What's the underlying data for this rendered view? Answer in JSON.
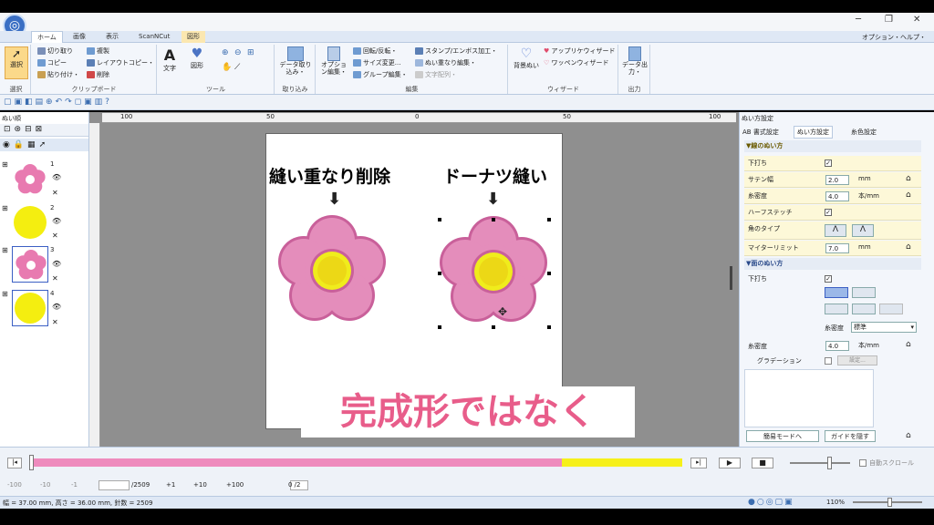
{
  "window": {
    "tabs": [
      "ホーム",
      "画像",
      "表示",
      "ScanNCut",
      "図形"
    ],
    "right_menu": "オプション・ヘルプ・"
  },
  "ribbon": {
    "select": "選択",
    "clipboard": {
      "cut": "切り取り",
      "copy": "コピー",
      "paste": "貼り付け・",
      "duplicate": "複製",
      "layout_copy": "レイアウトコピー・",
      "delete": "削除",
      "label": "クリップボード"
    },
    "tools": {
      "text": "文字",
      "shape": "図形",
      "label": "ツール"
    },
    "import": {
      "data_import": "データ取り込み・",
      "label": "取り込み"
    },
    "edit": {
      "option_edit": "オプション編集・",
      "rotate": "回転/反転・",
      "size": "サイズ変更...",
      "group": "グループ編集・",
      "stamp": "スタンプ/エンボス加工・",
      "overlap": "ぬい重なり編集・",
      "text_arrange": "文字配列・",
      "label": "編集"
    },
    "wizard": {
      "bg_sew": "背景ぬい",
      "applique": "アップリケウィザード",
      "wappen": "ワッペンウィザード",
      "label": "ウィザード"
    },
    "output": {
      "data_output": "データ出力・",
      "label": "出力"
    },
    "select_label": "選択"
  },
  "left_panel": {
    "title": "ぬい順",
    "items": [
      {
        "num": "1"
      },
      {
        "num": "2"
      },
      {
        "num": "3"
      },
      {
        "num": "4"
      }
    ]
  },
  "ruler": {
    "top": [
      "100",
      "50",
      "0",
      "50",
      "100"
    ]
  },
  "canvas": {
    "label_left": "縫い重なり削除",
    "label_right": "ドーナツ縫い"
  },
  "right_panel": {
    "title": "ぬい方設定",
    "tabs": [
      "AB 書式設定",
      "ぬい方設定",
      "糸色設定"
    ],
    "line_section": "▼線のぬい方",
    "rows": [
      {
        "label": "下打ち",
        "value": "✓"
      },
      {
        "label": "サテン幅",
        "value": "2.0",
        "unit": "mm"
      },
      {
        "label": "糸密度",
        "value": "4.0",
        "unit": "本/mm"
      },
      {
        "label": "ハーフステッチ",
        "value": "✓"
      },
      {
        "label": "角のタイプ",
        "value": ""
      },
      {
        "label": "マイターリミット",
        "value": "7.0",
        "unit": "mm"
      }
    ],
    "surface_section": "▼面のぬい方",
    "surface_underlay": "下打ち",
    "thread_density_sub": "糸密度",
    "thread_density_select": "標準",
    "density2": {
      "label": "糸密度",
      "value": "4.0",
      "unit": "本/mm"
    },
    "gradation": "グラデーション",
    "gradation_btn": "設定...",
    "simple_mode": "簡易モードへ",
    "hide_guide": "ガイドを隠す"
  },
  "playback": {
    "counter": "/2509",
    "step_buttons": [
      "-100",
      "-10",
      "-1",
      "+1",
      "+10",
      "+100"
    ],
    "page_counter": "0 /2",
    "auto_scroll": "自動スクロール"
  },
  "status": {
    "text": "幅 = 37.00 mm, 高さ = 36.00 mm, 針数 = 2509",
    "zoom": "110%"
  },
  "caption": "完成形ではなく"
}
